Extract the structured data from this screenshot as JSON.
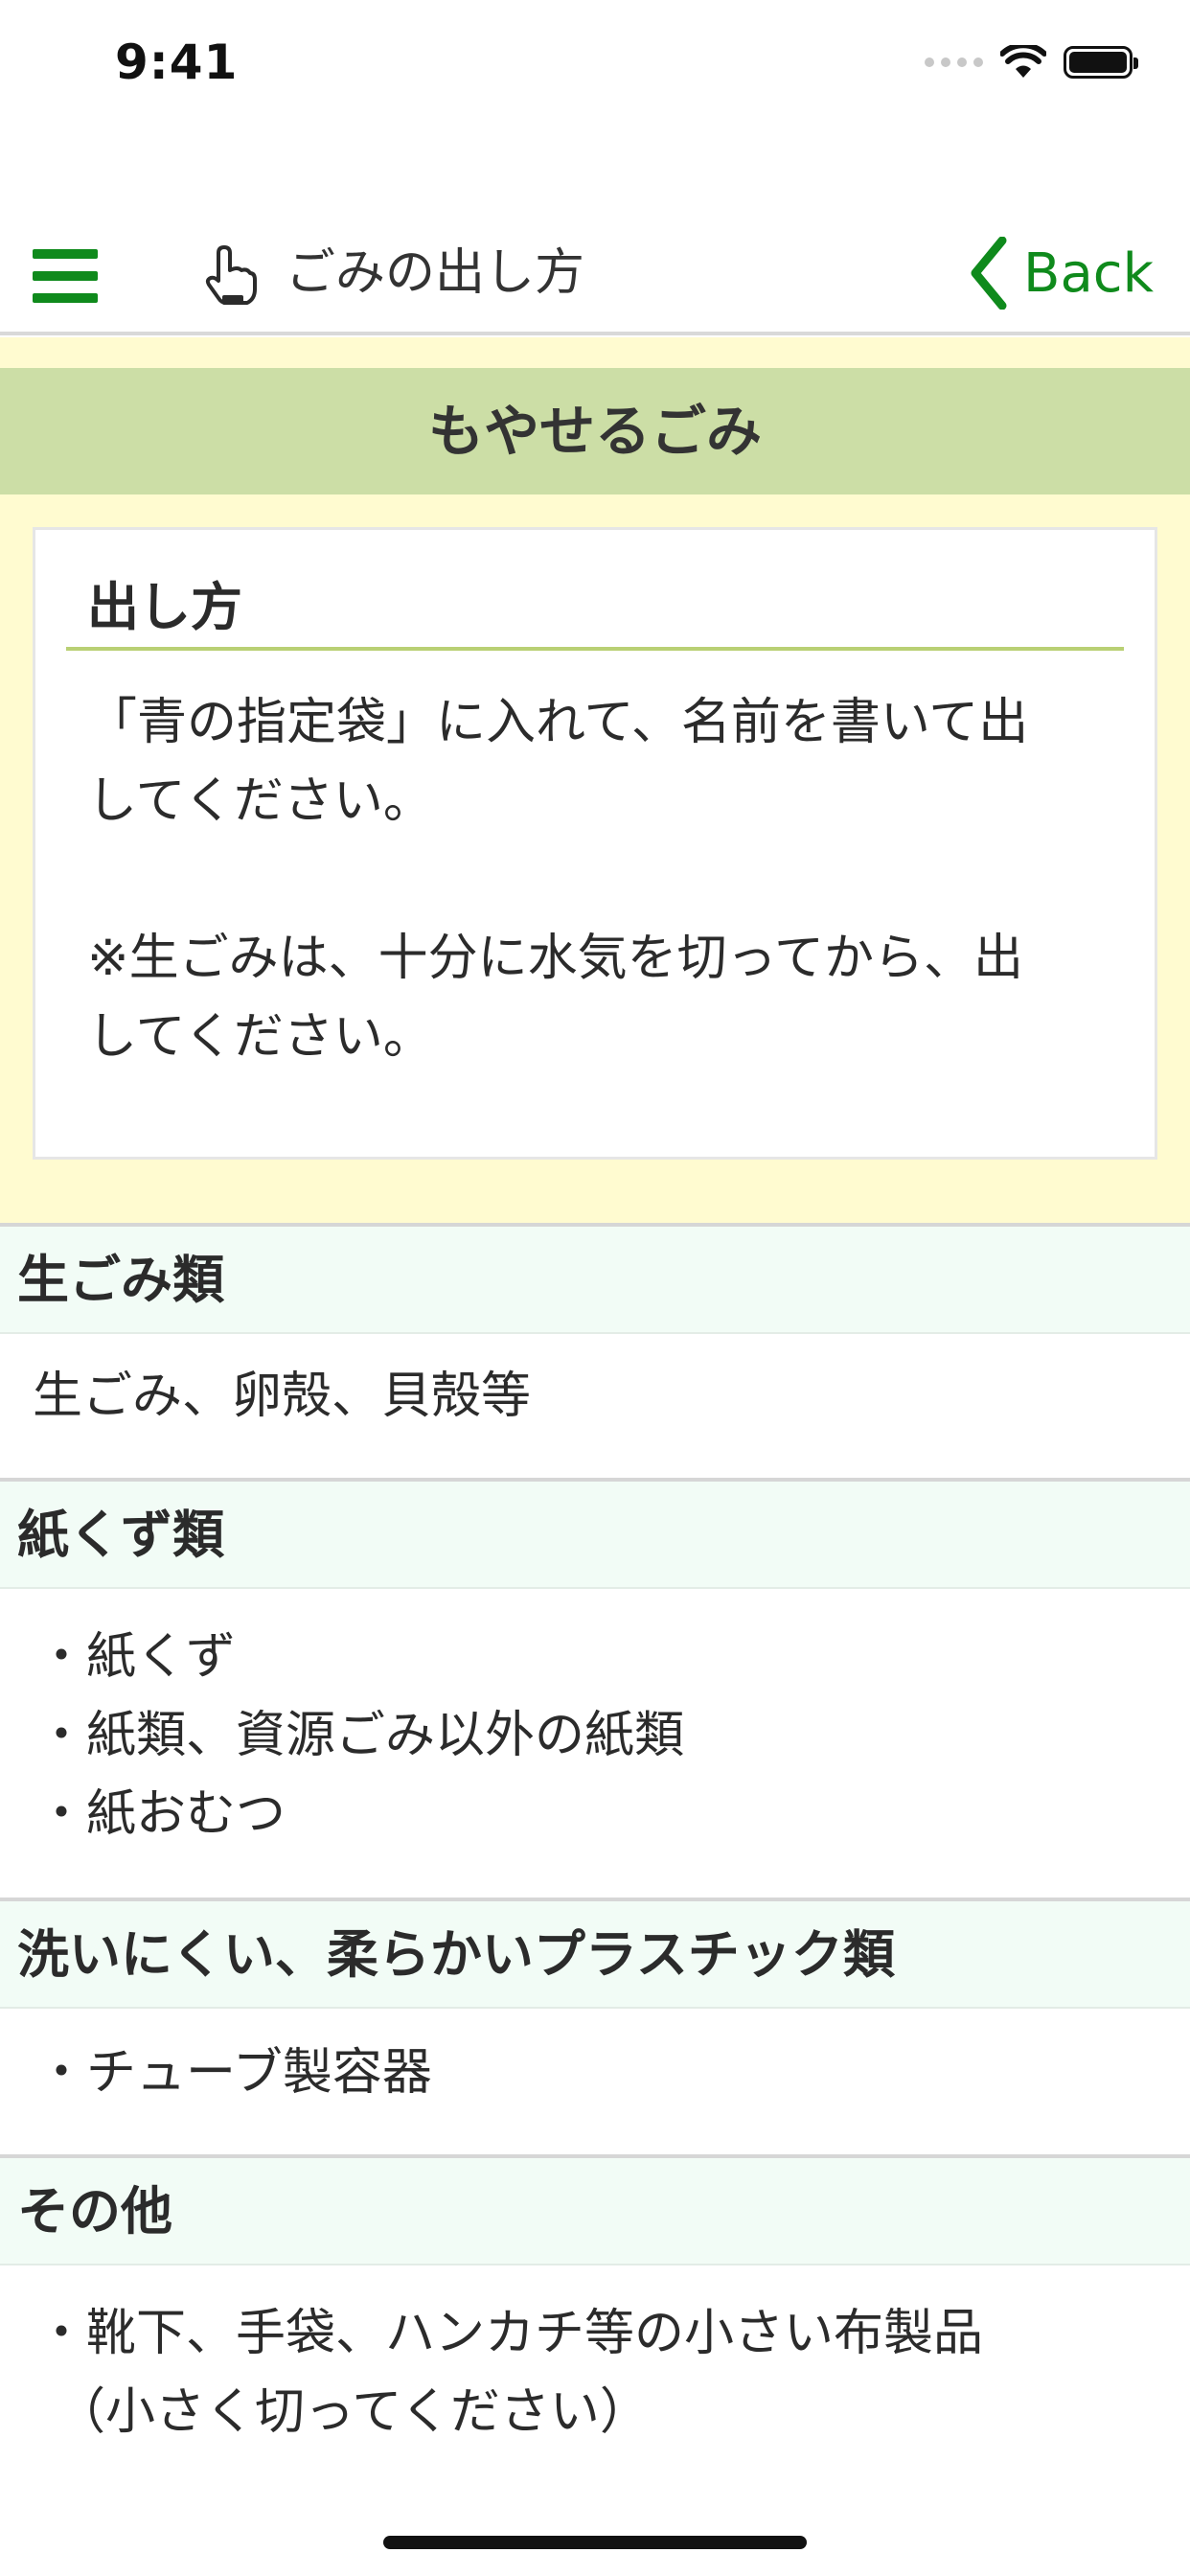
{
  "status_bar": {
    "time": "9:41"
  },
  "nav": {
    "title": "ごみの出し方",
    "back_label": "Back"
  },
  "header_banner": "もやせるごみ",
  "instructions": {
    "heading": "出し方",
    "text": "「青の指定袋」に入れて、名前を書いて出\nしてください。\n\n※生ごみは、十分に水気を切ってから、出\nしてください。"
  },
  "categories": [
    {
      "title": "生ごみ類",
      "items": [
        "生ごみ、卵殻、貝殻等"
      ]
    },
    {
      "title": "紙くず類",
      "items": [
        "・紙くず",
        "・紙類、資源ごみ以外の紙類",
        "・紙おむつ"
      ]
    },
    {
      "title": "洗いにくい、柔らかいプラスチック類",
      "items": [
        "・チューブ製容器"
      ]
    },
    {
      "title": "その他",
      "items": [
        "・靴下、手袋、ハンカチ等の小さい布製品",
        "（小さく切ってください）"
      ]
    }
  ],
  "icons": {
    "menu": "hamburger-menu-icon",
    "title": "pointing-hand-icon",
    "back": "chevron-left-icon",
    "signal": "cellular-signal-icon",
    "wifi": "wifi-icon",
    "battery": "battery-icon"
  },
  "colors": {
    "accent_green": "#0f8a1c",
    "banner_green": "#ccdea6",
    "yellow_bg": "#fffbd0",
    "category_bg": "#f2fcf6",
    "rule_green": "#b9d074"
  }
}
